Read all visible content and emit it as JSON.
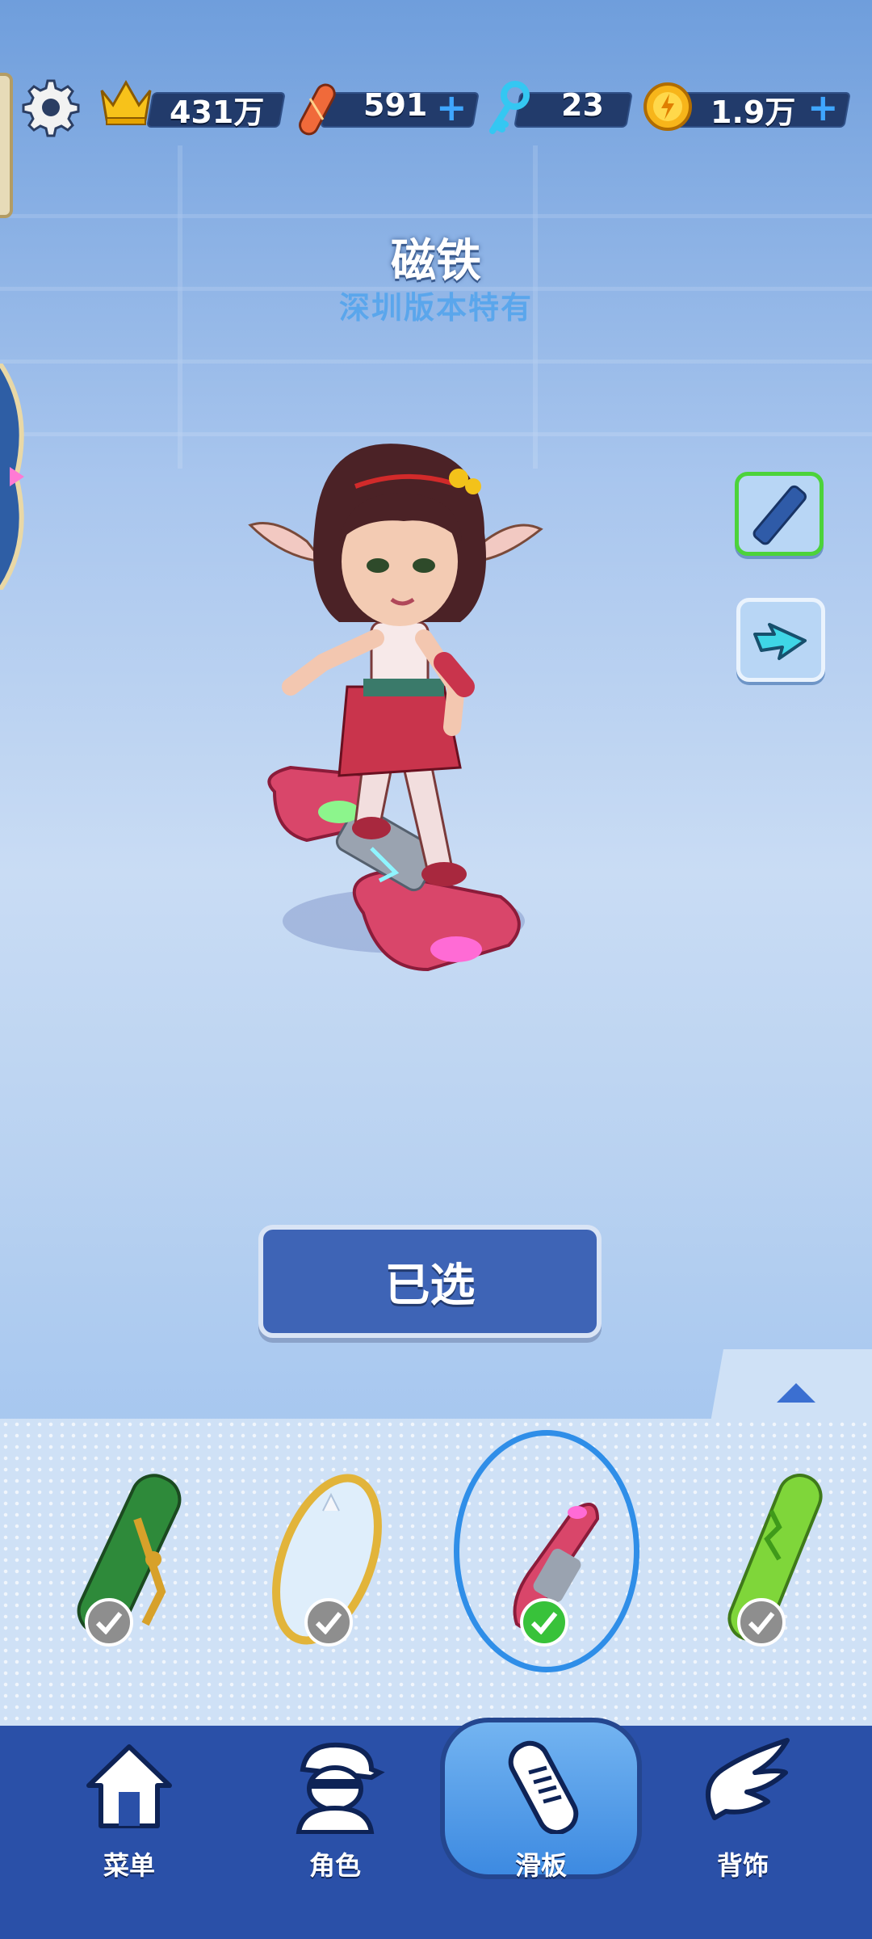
{
  "top_bar": {
    "settings_icon": "gear-icon",
    "crown_score": "431万",
    "boards_count": "591",
    "boards_plus": "+",
    "keys_count": "23",
    "coins_count": "1.9万",
    "coins_plus": "+"
  },
  "board": {
    "name": "磁铁",
    "subtitle": "深圳版本特有"
  },
  "side_buttons": [
    {
      "icon": "hoverboard-icon",
      "active": true
    },
    {
      "icon": "power-arrow-icon",
      "active": false
    }
  ],
  "select_button": {
    "label": "已选"
  },
  "tray": {
    "expand_icon": "chevron-up-icon",
    "items": [
      {
        "icon": "trumpet-board-icon",
        "checked": true,
        "selected": false
      },
      {
        "icon": "mirror-board-icon",
        "checked": true,
        "selected": false
      },
      {
        "icon": "magnet-board-icon",
        "checked": true,
        "selected": true
      },
      {
        "icon": "cactus-board-icon",
        "checked": true,
        "selected": false
      }
    ]
  },
  "nav": {
    "items": [
      {
        "label": "菜单",
        "icon": "home-icon"
      },
      {
        "label": "角色",
        "icon": "character-icon"
      },
      {
        "label": "滑板",
        "icon": "skateboard-icon"
      },
      {
        "label": "背饰",
        "icon": "wing-icon"
      }
    ],
    "active_index": 2
  },
  "colors": {
    "accent_blue": "#3e64b6",
    "nav_bg": "#2a50a8",
    "active_check": "#38c23a",
    "active_border": "#4cd33a"
  }
}
